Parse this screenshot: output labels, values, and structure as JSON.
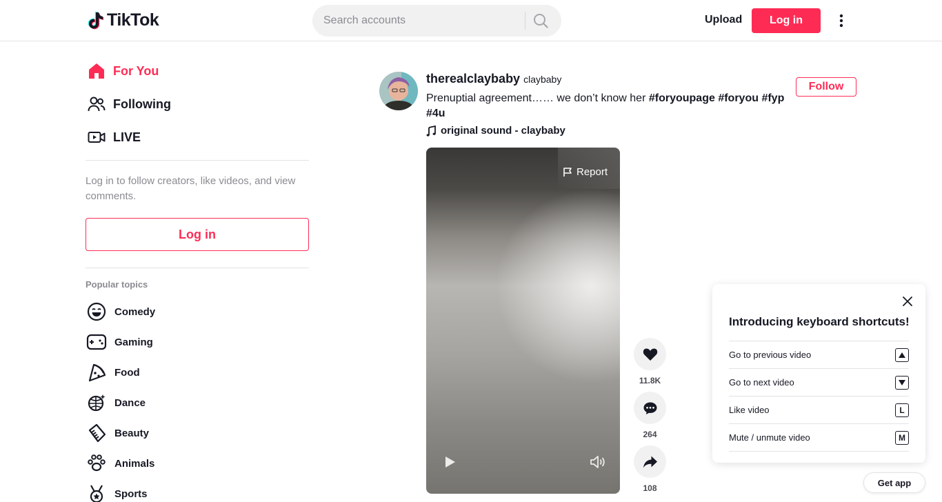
{
  "header": {
    "logo_text": "TikTok",
    "search_placeholder": "Search accounts",
    "upload_label": "Upload",
    "login_label": "Log in"
  },
  "sidebar": {
    "nav": [
      {
        "label": "For You",
        "icon": "home-icon",
        "active": true
      },
      {
        "label": "Following",
        "icon": "people-icon"
      },
      {
        "label": "LIVE",
        "icon": "live-icon"
      }
    ],
    "login_prompt": "Log in to follow creators, like videos, and view comments.",
    "login_label": "Log in",
    "topics_title": "Popular topics",
    "topics": [
      {
        "label": "Comedy",
        "icon": "smile-icon"
      },
      {
        "label": "Gaming",
        "icon": "gamepad-icon"
      },
      {
        "label": "Food",
        "icon": "pizza-icon"
      },
      {
        "label": "Dance",
        "icon": "disco-ball-icon"
      },
      {
        "label": "Beauty",
        "icon": "comb-icon"
      },
      {
        "label": "Animals",
        "icon": "paw-icon"
      },
      {
        "label": "Sports",
        "icon": "medal-icon"
      }
    ]
  },
  "post": {
    "author_name": "therealclaybaby",
    "author_nick": "claybaby",
    "caption_text": "Prenuptial agreement…… we don’t know her ",
    "hashtags": [
      "#foryoupage",
      "#foryou",
      "#fyp",
      "#4u"
    ],
    "music": "original sound - claybaby",
    "follow_label": "Follow",
    "report_label": "Report",
    "likes": "11.8K",
    "comments": "264",
    "shares": "108"
  },
  "shortcuts": {
    "title": "Introducing keyboard shortcuts!",
    "items": [
      {
        "label": "Go to previous video",
        "key": "▲"
      },
      {
        "label": "Go to next video",
        "key": "▼"
      },
      {
        "label": "Like video",
        "key": "L"
      },
      {
        "label": "Mute / unmute video",
        "key": "M"
      }
    ]
  },
  "get_app_label": "Get app",
  "colors": {
    "brand": "#fe2c55",
    "text": "#161823",
    "muted": "#8a8b91"
  }
}
